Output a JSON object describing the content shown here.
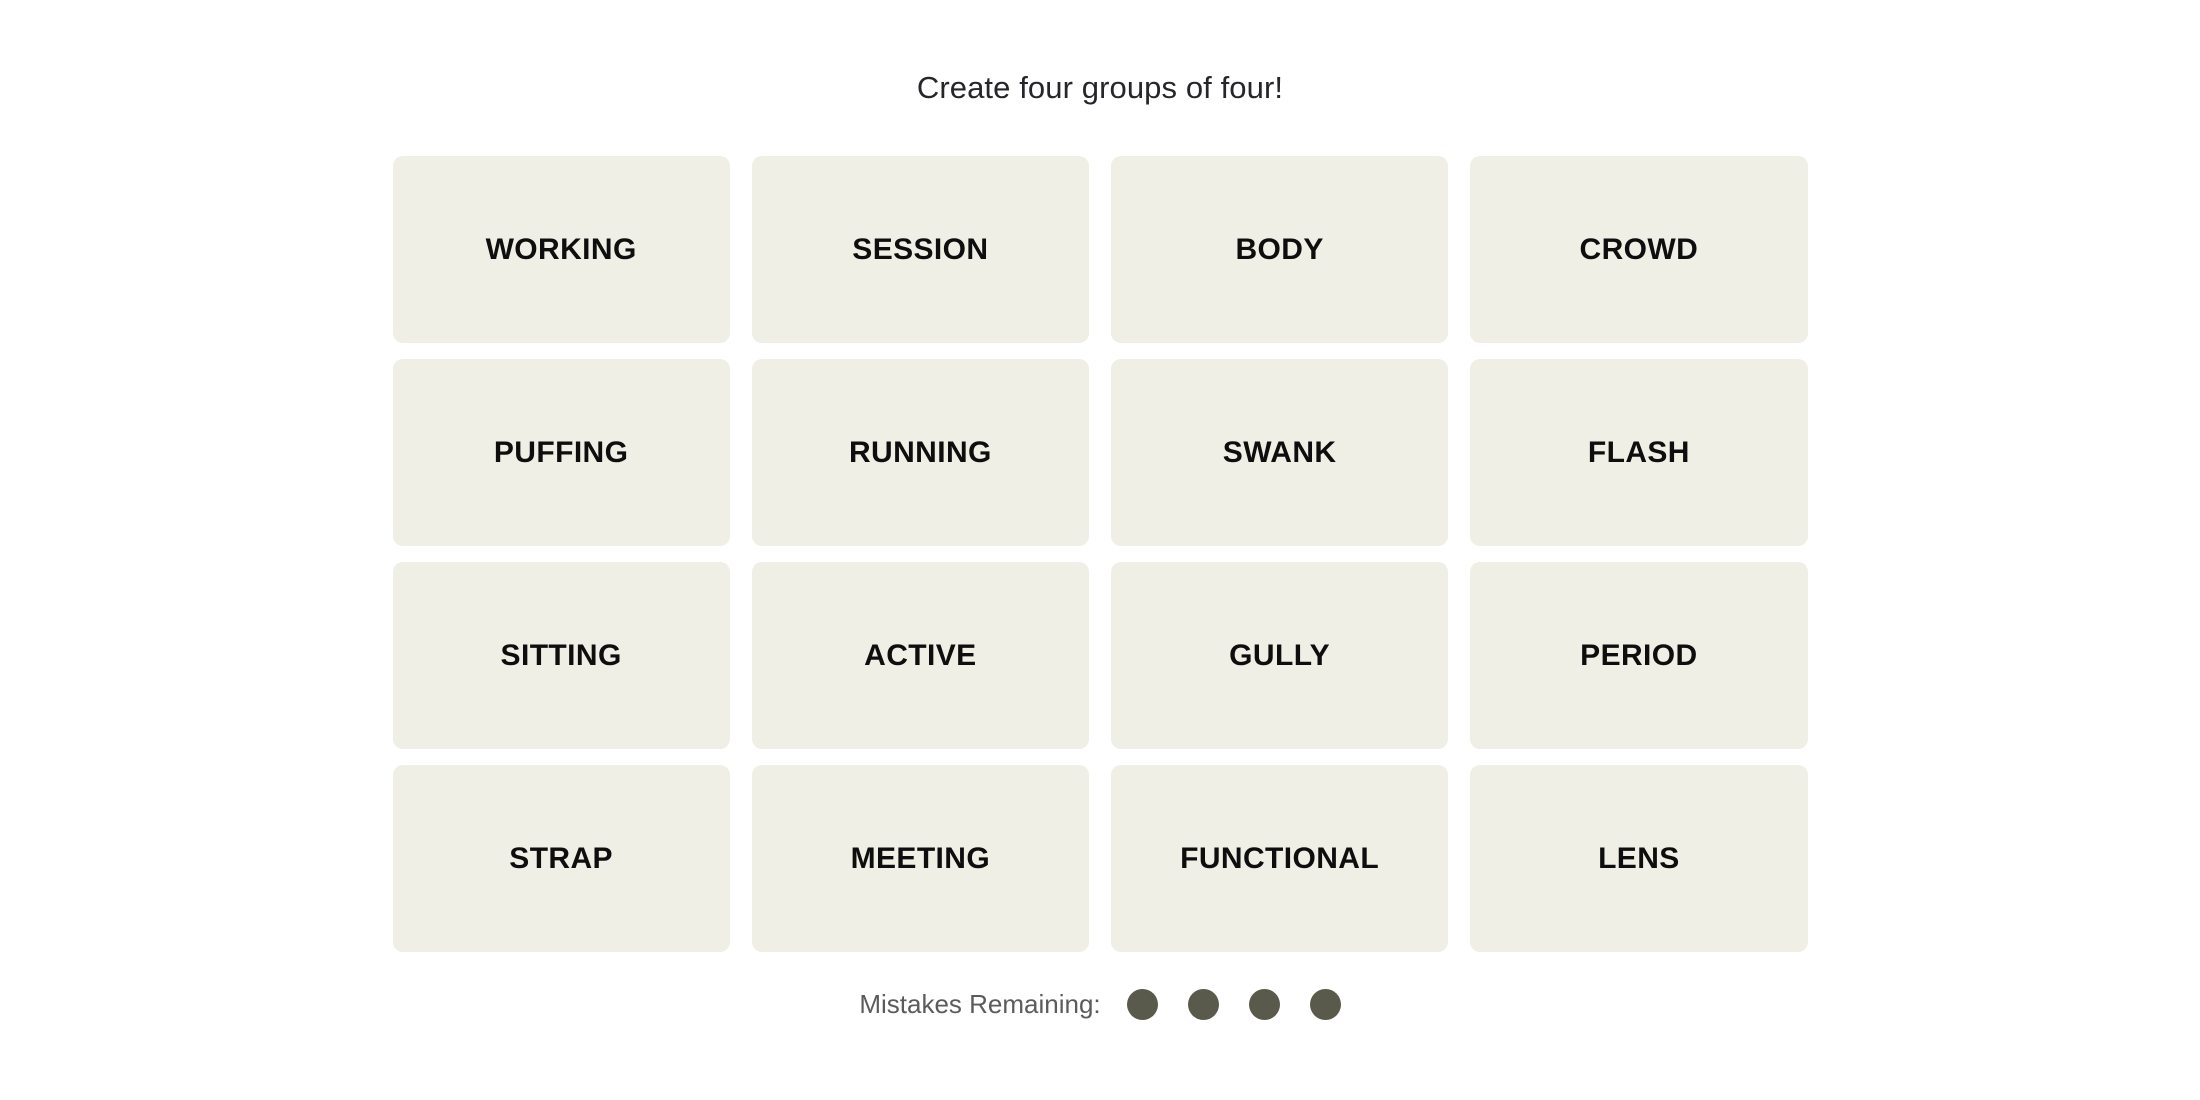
{
  "page": {
    "background_color": "#ffffff"
  },
  "instruction": {
    "text": "Create four groups of four!",
    "color": "#26262a"
  },
  "board": {
    "rows": 4,
    "columns": 4,
    "tile_background_color": "#efefe6",
    "tile_text_color": "#0e0e0e",
    "tiles": [
      {
        "word": "WORKING"
      },
      {
        "word": "SESSION"
      },
      {
        "word": "BODY"
      },
      {
        "word": "CROWD"
      },
      {
        "word": "PUFFING"
      },
      {
        "word": "RUNNING"
      },
      {
        "word": "SWANK"
      },
      {
        "word": "FLASH"
      },
      {
        "word": "SITTING"
      },
      {
        "word": "ACTIVE"
      },
      {
        "word": "GULLY"
      },
      {
        "word": "PERIOD"
      },
      {
        "word": "STRAP"
      },
      {
        "word": "MEETING"
      },
      {
        "word": "FUNCTIONAL"
      },
      {
        "word": "LENS"
      }
    ]
  },
  "mistakes": {
    "label": "Mistakes Remaining:",
    "label_color": "#5b5b5b",
    "remaining": 4,
    "dot_color": "#5a5a4c",
    "dots": [
      {
        "name": "mistake-dot-1"
      },
      {
        "name": "mistake-dot-2"
      },
      {
        "name": "mistake-dot-3"
      },
      {
        "name": "mistake-dot-4"
      }
    ]
  }
}
